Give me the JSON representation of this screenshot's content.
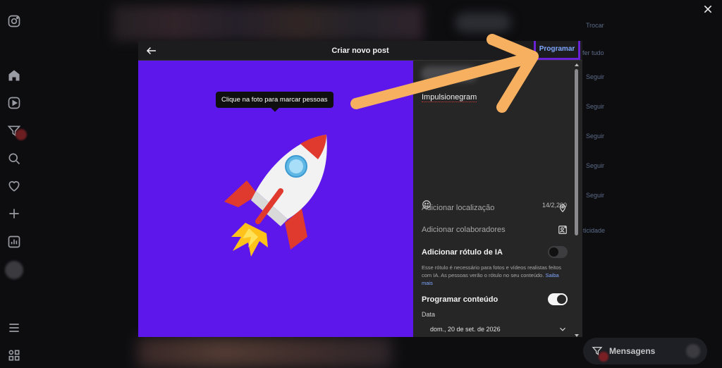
{
  "modal": {
    "title": "Criar novo post",
    "schedule_button": "Programar"
  },
  "photo": {
    "tag_tooltip": "Clique na foto para marcar pessoas",
    "background_color": "#5e17eb"
  },
  "panel": {
    "caption": "Impulsionegram",
    "char_count": "14/2,200",
    "add_location": "Adicionar localização",
    "add_collaborators": "Adicionar colaboradores",
    "ai_label_title": "Adicionar rótulo de IA",
    "ai_label_description": "Esse rótulo é necessário para fotos e vídeos realistas feitos com IA. As pessoas verão o rótulo no seu conteúdo.",
    "ai_label_learn_more": "Saiba mais",
    "ai_label_enabled": false,
    "schedule_title": "Programar conteúdo",
    "schedule_enabled": true,
    "date_label": "Data",
    "date_value": "dom., 20 de set. de 2026"
  },
  "background": {
    "right_links": [
      "Trocar",
      "fer tudo",
      "Seguir",
      "Seguir",
      "Seguir",
      "Seguir",
      "Seguir",
      "ticidade"
    ],
    "messages_label": "Mensagens"
  },
  "icons": {
    "sidebar": [
      "instagram-icon",
      "home-icon",
      "reels-icon",
      "messages-icon",
      "search-icon",
      "heart-icon",
      "create-icon",
      "insights-icon",
      "menu-icon",
      "apps-icon"
    ],
    "annotation_color": "#f7b060",
    "highlight_color": "#6a22d6"
  }
}
